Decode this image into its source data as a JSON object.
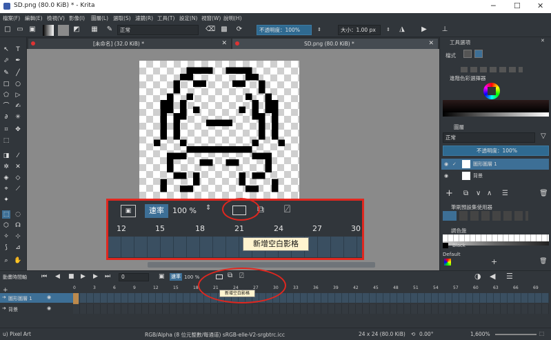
{
  "window": {
    "title": "SD.png (80.0 KiB) * - Krita",
    "controls": [
      "─",
      "☐",
      "✕"
    ]
  },
  "menu": [
    "檔案(F)",
    "編輯(E)",
    "檢視(V)",
    "影像(I)",
    "圖層(L)",
    "選取(S)",
    "濾鏡(R)",
    "工具(T)",
    "設定(N)",
    "視窗(W)",
    "說明(H)"
  ],
  "toolbar": {
    "blend_mode": "正常",
    "opacity_label": "不透明度：100%",
    "size_label": "大小：1.00 px"
  },
  "tabs": [
    {
      "label": "[未命名] (32.0 KiB) *"
    },
    {
      "label": "SD.png (80.0 KiB) *"
    }
  ],
  "zoom": {
    "speed_label": "速率",
    "percent": "100 %",
    "frames": [
      "12",
      "15",
      "18",
      "21",
      "24",
      "27",
      "30"
    ],
    "tooltip": "新增空白影格"
  },
  "dock": {
    "tool_options": "工具選項",
    "mode": "檔式",
    "color_selector": "進階色彩選擇器",
    "layers": "圖層",
    "blend": "正常",
    "opacity": "不透明度：100%",
    "layer_rows": [
      {
        "name": "圖形圖層 1"
      },
      {
        "name": "背景"
      }
    ],
    "brush_presets": "筆刷預設集使用器",
    "palette": "調色盤",
    "color_name": "Black",
    "palette_name": "Default"
  },
  "timeline": {
    "title": "動畫時間軸",
    "frame_number": "0",
    "speed_label": "速率",
    "percent": "100 %",
    "ruler": [
      "0",
      "3",
      "6",
      "9",
      "12",
      "15",
      "18",
      "21",
      "24",
      "27",
      "30",
      "33",
      "36",
      "39",
      "42",
      "45",
      "48",
      "51",
      "54",
      "57",
      "60",
      "63",
      "66",
      "69"
    ],
    "layers": [
      "圖形圖層 1",
      "背景"
    ],
    "tooltip": "新增空白影格"
  },
  "status": {
    "brush": "u) Pixel Art",
    "color_space": "RGB/Alpha (8 位元整數/每通道) sRGB-elle-V2-srgbtrc.icc",
    "dimensions": "24 x 24 (80.0 KiB)",
    "angle": "0.00°",
    "zoom": "1,600%"
  }
}
